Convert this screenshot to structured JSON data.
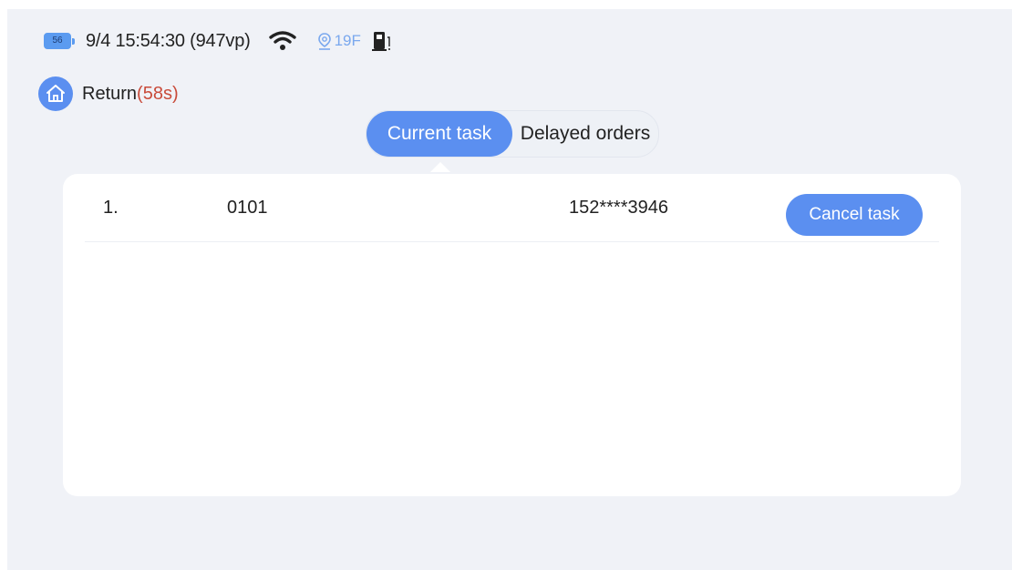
{
  "status_bar": {
    "battery_level": "56",
    "datetime_info": "9/4 15:54:30 (947vp)",
    "floor_label": "19F",
    "icons": [
      "battery-icon",
      "wifi-icon",
      "location-pin-icon",
      "charging-station-icon"
    ]
  },
  "navigation": {
    "return_label": "Return",
    "return_countdown": "(58s)",
    "icon": "home-icon"
  },
  "tabs": [
    {
      "label": "Current task",
      "active": true
    },
    {
      "label": "Delayed orders",
      "active": false
    }
  ],
  "tasks": [
    {
      "index": "1.",
      "code": "0101",
      "phone": "152****3946",
      "action_label": "Cancel task"
    }
  ],
  "colors": {
    "accent": "#5b8ff0",
    "background": "#f0f2f7",
    "card": "#ffffff",
    "countdown": "#c94b3a",
    "floor_text": "#7aa8ee"
  }
}
